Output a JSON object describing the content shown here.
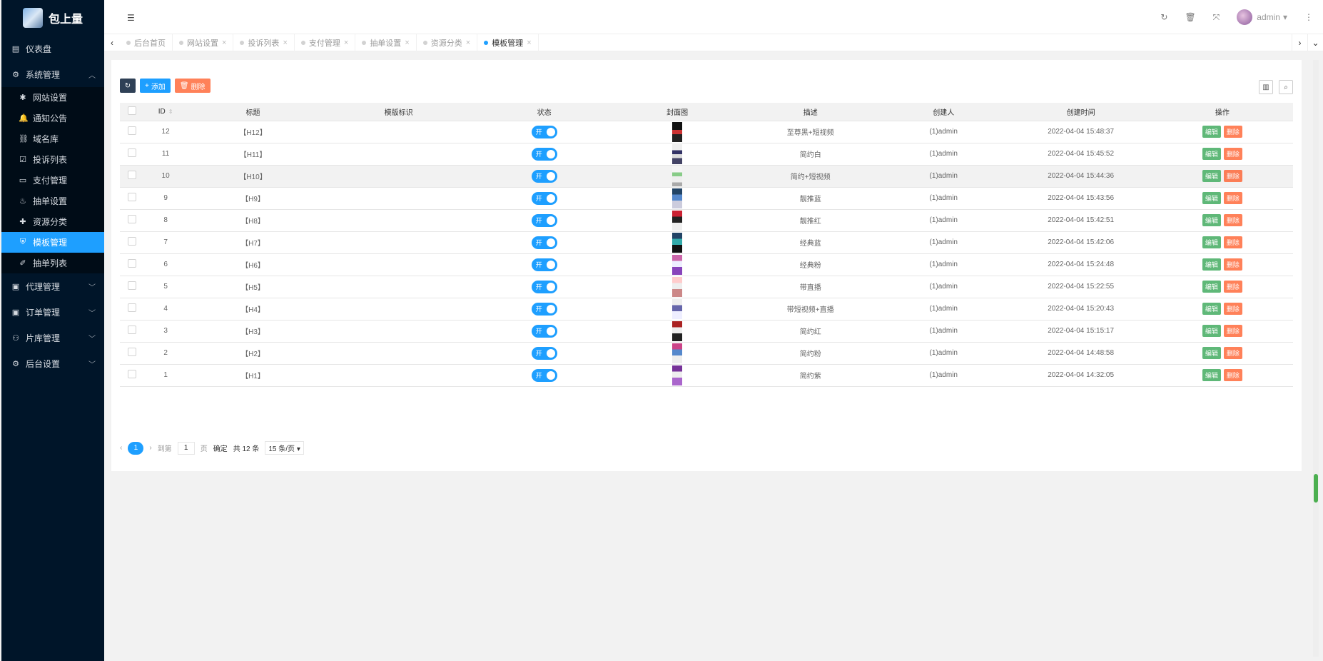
{
  "app": {
    "name": "包上量"
  },
  "sidebar": {
    "dashboard": "仪表盘",
    "system": "系统管理",
    "sub_items": [
      {
        "label": "网站设置",
        "icon": "gear-icon",
        "glyph": "✱"
      },
      {
        "label": "通知公告",
        "icon": "bell-icon",
        "glyph": "🔔"
      },
      {
        "label": "域名库",
        "icon": "link-icon",
        "glyph": "⛓"
      },
      {
        "label": "投诉列表",
        "icon": "checkbox-icon",
        "glyph": "☑"
      },
      {
        "label": "支付管理",
        "icon": "credit-card-icon",
        "glyph": "▭"
      },
      {
        "label": "抽单设置",
        "icon": "cake-icon",
        "glyph": "♨"
      },
      {
        "label": "资源分类",
        "icon": "bolt-icon",
        "glyph": "✚"
      },
      {
        "label": "模板管理",
        "icon": "shield-icon",
        "glyph": "⛨"
      },
      {
        "label": "抽单列表",
        "icon": "leaf-icon",
        "glyph": "✐"
      }
    ],
    "groups": [
      {
        "label": "代理管理",
        "icon": "agent-icon"
      },
      {
        "label": "订单管理",
        "icon": "order-icon"
      },
      {
        "label": "片库管理",
        "icon": "film-icon"
      },
      {
        "label": "后台设置",
        "icon": "cogs-icon"
      }
    ]
  },
  "header": {
    "user": "admin"
  },
  "tabs": [
    "后台首页",
    "网站设置",
    "投诉列表",
    "支付管理",
    "抽单设置",
    "资源分类",
    "模板管理"
  ],
  "toolbar": {
    "add": "添加",
    "delete": "删除"
  },
  "table": {
    "columns": [
      "ID",
      "标题",
      "模版标识",
      "状态",
      "封面图",
      "描述",
      "创建人",
      "创建时间",
      "操作"
    ],
    "switch_label": "开",
    "edit_label": "编辑",
    "delete_label": "删除",
    "rows": [
      {
        "id": "12",
        "title": "【H12】",
        "desc": "至尊黑+短视频",
        "creator": "(1)admin",
        "time": "2022-04-04 15:48:37"
      },
      {
        "id": "11",
        "title": "【H11】",
        "desc": "简约白",
        "creator": "(1)admin",
        "time": "2022-04-04 15:45:52"
      },
      {
        "id": "10",
        "title": "【H10】",
        "desc": "简约+短视频",
        "creator": "(1)admin",
        "time": "2022-04-04 15:44:36"
      },
      {
        "id": "9",
        "title": "【H9】",
        "desc": "靓推蓝",
        "creator": "(1)admin",
        "time": "2022-04-04 15:43:56"
      },
      {
        "id": "8",
        "title": "【H8】",
        "desc": "靓推红",
        "creator": "(1)admin",
        "time": "2022-04-04 15:42:51"
      },
      {
        "id": "7",
        "title": "【H7】",
        "desc": "经典蓝",
        "creator": "(1)admin",
        "time": "2022-04-04 15:42:06"
      },
      {
        "id": "6",
        "title": "【H6】",
        "desc": "经典粉",
        "creator": "(1)admin",
        "time": "2022-04-04 15:24:48"
      },
      {
        "id": "5",
        "title": "【H5】",
        "desc": "带直播",
        "creator": "(1)admin",
        "time": "2022-04-04 15:22:55"
      },
      {
        "id": "4",
        "title": "【H4】",
        "desc": "带短视频+直播",
        "creator": "(1)admin",
        "time": "2022-04-04 15:20:43"
      },
      {
        "id": "3",
        "title": "【H3】",
        "desc": "简约红",
        "creator": "(1)admin",
        "time": "2022-04-04 15:15:17"
      },
      {
        "id": "2",
        "title": "【H2】",
        "desc": "简约粉",
        "creator": "(1)admin",
        "time": "2022-04-04 14:48:58"
      },
      {
        "id": "1",
        "title": "【H1】",
        "desc": "简约紫",
        "creator": "(1)admin",
        "time": "2022-04-04 14:32:05"
      }
    ]
  },
  "pagination": {
    "current": "1",
    "goto_label": "到第",
    "page_value": "1",
    "page_unit": "页",
    "confirm": "确定",
    "total": "共 12 条",
    "page_size": "15 条/页"
  },
  "colors": {
    "sidebar_bg": "#001529",
    "primary": "#1e9fff",
    "edit": "#5fb878",
    "danger": "#ff5722"
  }
}
